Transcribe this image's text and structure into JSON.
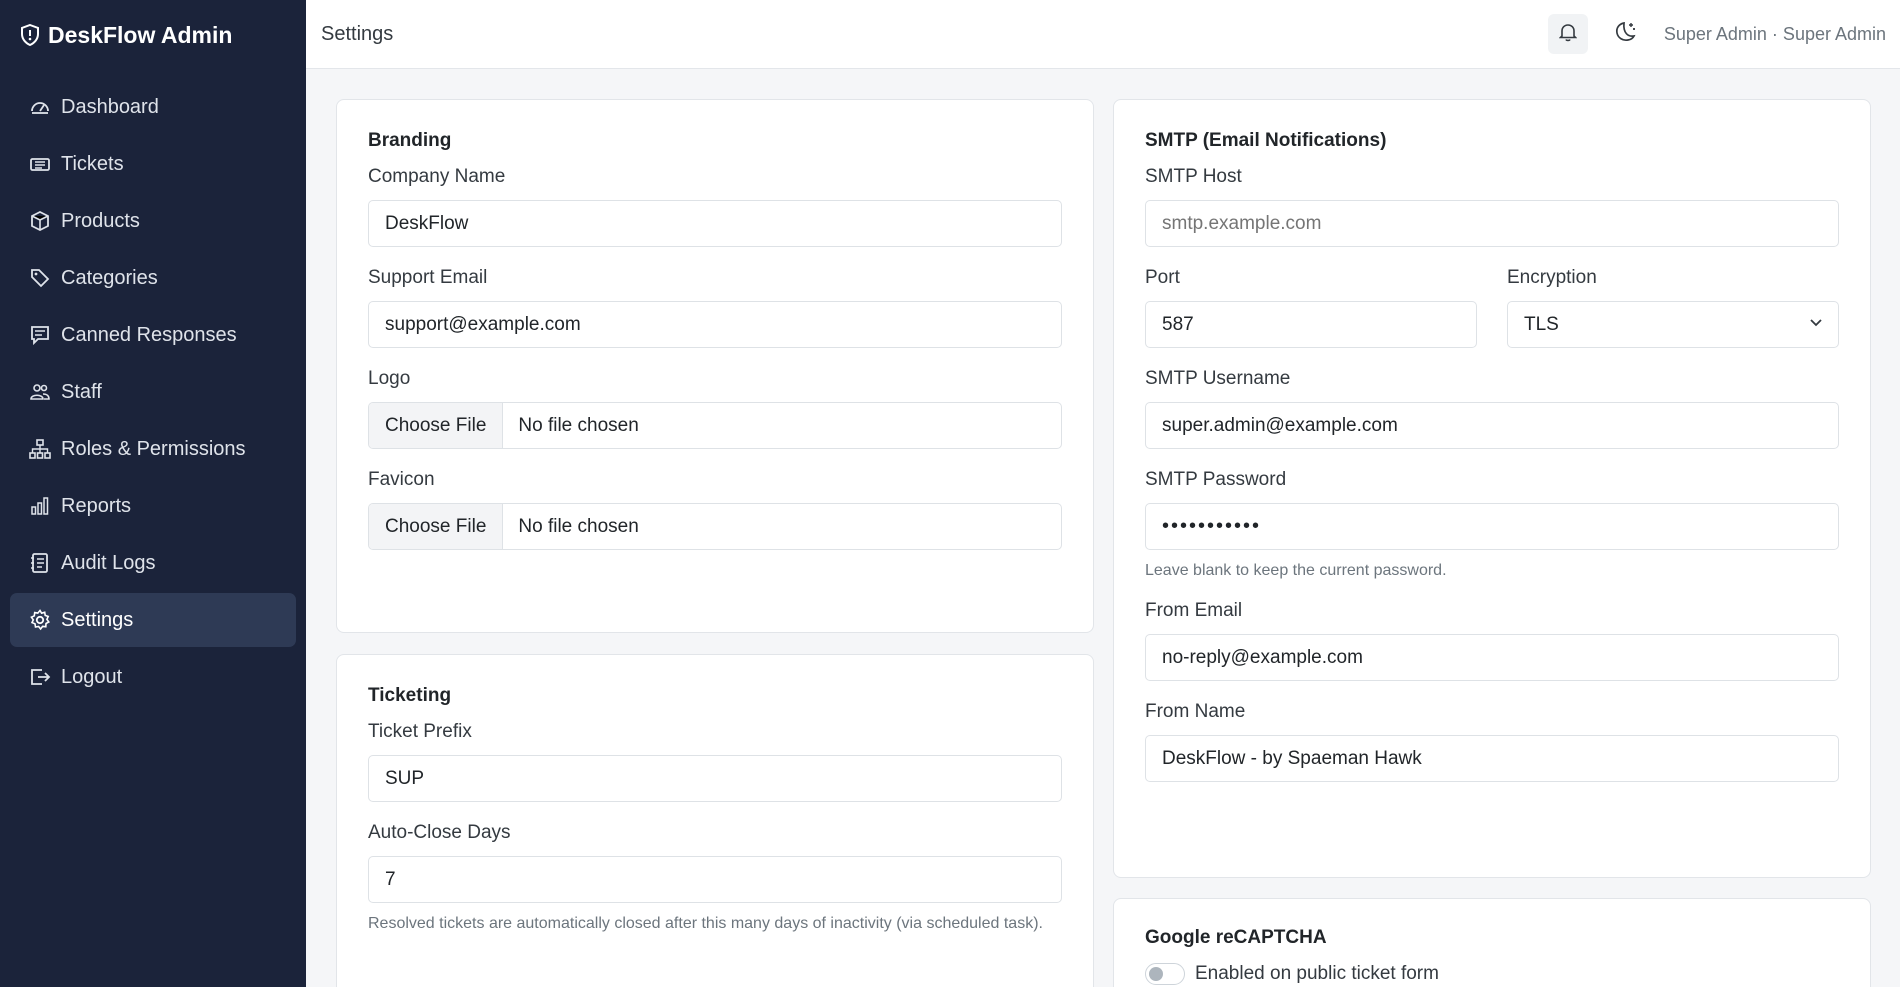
{
  "brand": {
    "name": "DeskFlow Admin"
  },
  "sidebar": {
    "items": [
      {
        "label": "Dashboard",
        "icon": "speedometer-icon"
      },
      {
        "label": "Tickets",
        "icon": "ticket-icon"
      },
      {
        "label": "Products",
        "icon": "box-icon"
      },
      {
        "label": "Categories",
        "icon": "tag-icon"
      },
      {
        "label": "Canned Responses",
        "icon": "chat-icon"
      },
      {
        "label": "Staff",
        "icon": "people-icon"
      },
      {
        "label": "Roles & Permissions",
        "icon": "diagram-icon"
      },
      {
        "label": "Reports",
        "icon": "bar-chart-icon"
      },
      {
        "label": "Audit Logs",
        "icon": "journal-icon"
      },
      {
        "label": "Settings",
        "icon": "gear-icon",
        "active": true
      },
      {
        "label": "Logout",
        "icon": "logout-icon"
      }
    ]
  },
  "topbar": {
    "title": "Settings",
    "user": "Super Admin · Super Admin"
  },
  "branding": {
    "title": "Branding",
    "company_label": "Company Name",
    "company_value": "DeskFlow",
    "email_label": "Support Email",
    "email_value": "support@example.com",
    "logo_label": "Logo",
    "favicon_label": "Favicon",
    "choose_file": "Choose File",
    "no_file": "No file chosen"
  },
  "ticketing": {
    "title": "Ticketing",
    "prefix_label": "Ticket Prefix",
    "prefix_value": "SUP",
    "autoclose_label": "Auto-Close Days",
    "autoclose_value": "7",
    "autoclose_help": "Resolved tickets are automatically closed after this many days of inactivity (via scheduled task)."
  },
  "smtp": {
    "title": "SMTP (Email Notifications)",
    "host_label": "SMTP Host",
    "host_placeholder": "smtp.example.com",
    "port_label": "Port",
    "port_value": "587",
    "encryption_label": "Encryption",
    "encryption_value": "TLS",
    "username_label": "SMTP Username",
    "username_value": "super.admin@example.com",
    "password_label": "SMTP Password",
    "password_value": "•••••••••••",
    "password_help": "Leave blank to keep the current password.",
    "from_email_label": "From Email",
    "from_email_value": "no-reply@example.com",
    "from_name_label": "From Name",
    "from_name_value": "DeskFlow - by Spaeman Hawk"
  },
  "recaptcha": {
    "title": "Google reCAPTCHA",
    "toggle_label": "Enabled on public ticket form"
  },
  "colors": {
    "sidebar_bg": "#1b233a",
    "sidebar_active": "#2e3a55",
    "page_bg": "#f5f6f8"
  }
}
